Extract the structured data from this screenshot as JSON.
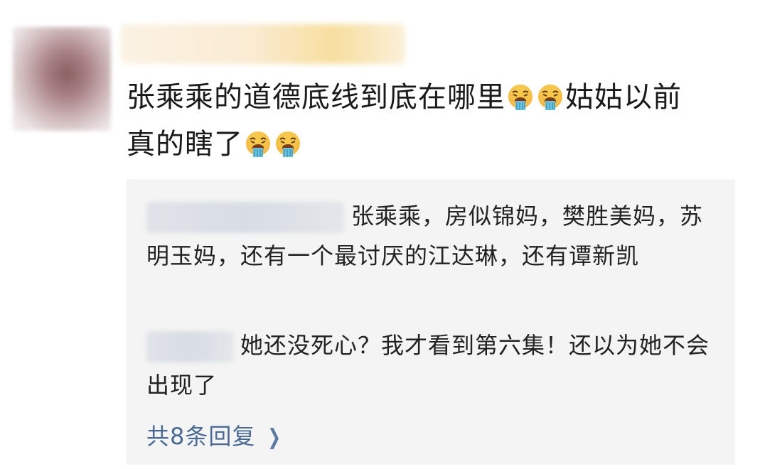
{
  "comment": {
    "text_part1": "张乘乘的道德底线到底在哪里",
    "text_part2": "姑姑以前",
    "text_part3": "真的瞎了",
    "emoji_icon": "vomiting-face-icon"
  },
  "replies": [
    {
      "text": "张乘乘，房似锦妈，樊胜美妈，苏明玉妈，还有一个最讨厌的江达琳，还有谭新凯"
    },
    {
      "text": "她还没死心？我才看到第六集！还以为她不会出现了"
    }
  ],
  "more_replies": {
    "label": "共8条回复",
    "icon": "chevron-right-icon"
  },
  "colors": {
    "reply_background": "#f4f4f4",
    "link_color": "#4a6a94"
  }
}
